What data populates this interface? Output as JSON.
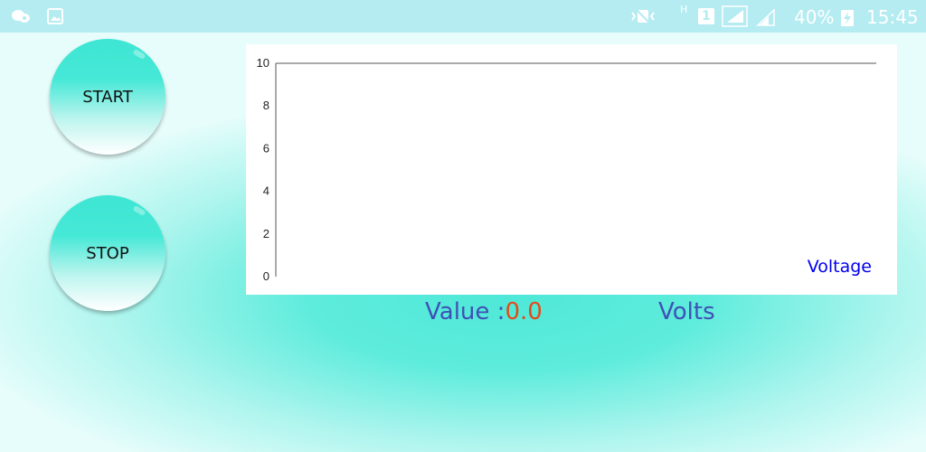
{
  "status_bar": {
    "battery_percent": "40%",
    "time": "15:45",
    "icons": [
      "notification-icon",
      "image-icon",
      "vibrate-icon",
      "network-type-icon",
      "sim-icon",
      "signal-icon",
      "signal-icon-2",
      "charging-icon"
    ],
    "network_type": "H",
    "sim_slot": "1"
  },
  "controls": {
    "start_label": "START",
    "stop_label": "STOP"
  },
  "chart_data": {
    "type": "line",
    "title": "",
    "xlabel": "",
    "ylabel": "",
    "ylim": [
      0,
      10
    ],
    "yticks": [
      "0",
      "2",
      "4",
      "6",
      "8",
      "10"
    ],
    "series": [
      {
        "name": "Voltage",
        "values": []
      }
    ],
    "legend_position": "bottom-right",
    "colors": {
      "legend": "#0000ee",
      "axis": "#555555"
    }
  },
  "readout": {
    "prefix": "Value :",
    "value": "0.0",
    "unit": "Volts",
    "colors": {
      "label": "#3f51b5",
      "value": "#e64a19"
    }
  }
}
